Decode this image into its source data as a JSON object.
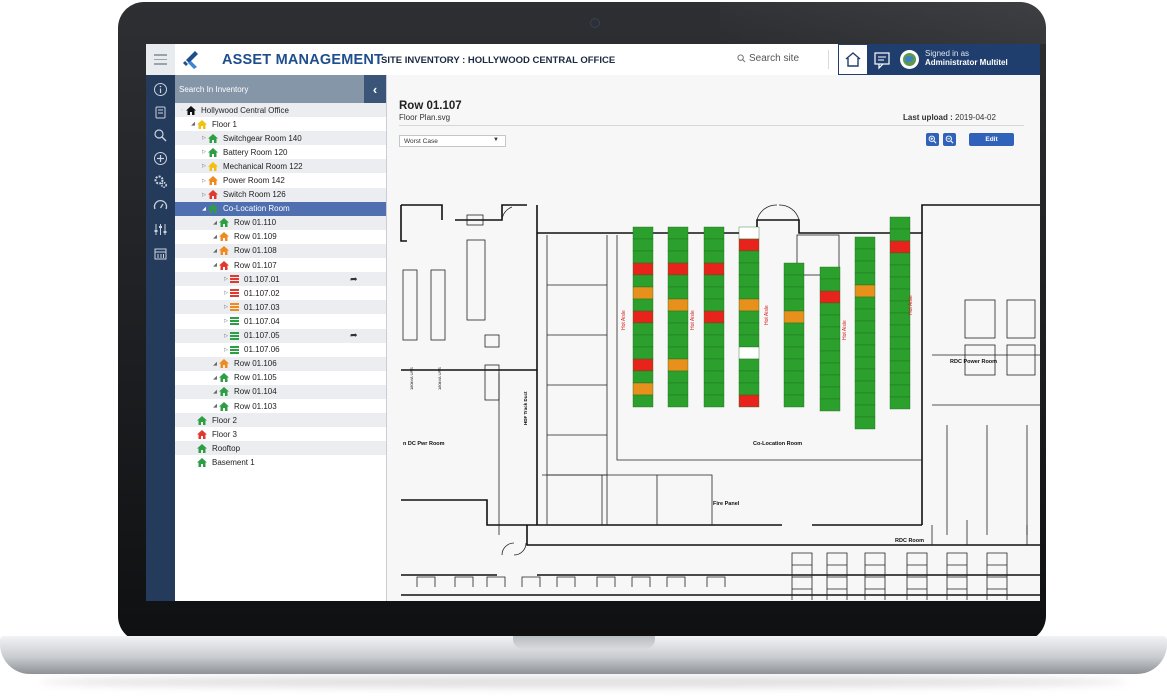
{
  "header": {
    "app_title": "ASSET MANAGEMENT",
    "site_title": "SITE INVENTORY : HOLLYWOOD CENTRAL OFFICE",
    "search_placeholder": "Search site",
    "signed_in_label": "Signed in as",
    "signed_in_user": "Administrator Multitel"
  },
  "sidebar": {
    "search_label": "Search In Inventory",
    "icons": [
      "info-icon",
      "document-icon",
      "search-icon",
      "add-icon",
      "settings-icon",
      "dashboard-icon",
      "sliders-icon",
      "calendar-icon"
    ]
  },
  "tree": [
    {
      "label": "Hollywood Central Office",
      "depth": 0,
      "icon": "home-icon",
      "color": "#111111",
      "toggle": "·"
    },
    {
      "label": "Floor 1",
      "depth": 1,
      "icon": "house-icon",
      "color": "#f2c10f",
      "toggle": "◢"
    },
    {
      "label": "Switchgear Room 140",
      "depth": 2,
      "icon": "house-icon",
      "color": "#2e9e45",
      "toggle": "▷"
    },
    {
      "label": "Battery Room 120",
      "depth": 2,
      "icon": "house-icon",
      "color": "#2e9e45",
      "toggle": "▷"
    },
    {
      "label": "Mechanical Room 122",
      "depth": 2,
      "icon": "house-icon",
      "color": "#f2c10f",
      "toggle": "▷"
    },
    {
      "label": "Power Room 142",
      "depth": 2,
      "icon": "house-icon",
      "color": "#ef8a1f",
      "toggle": "▷"
    },
    {
      "label": "Switch Room 126",
      "depth": 2,
      "icon": "house-icon",
      "color": "#e03a2e",
      "toggle": "▷"
    },
    {
      "label": "Co-Location Room",
      "depth": 2,
      "icon": "house-icon",
      "color": "#2e9e45",
      "toggle": "◢",
      "selected": true
    },
    {
      "label": "Row 01.110",
      "depth": 3,
      "icon": "house-icon",
      "color": "#2e9e45",
      "toggle": "◢"
    },
    {
      "label": "Row 01.109",
      "depth": 3,
      "icon": "house-icon",
      "color": "#ef8a1f",
      "toggle": "◢"
    },
    {
      "label": "Row 01.108",
      "depth": 3,
      "icon": "house-icon",
      "color": "#ef8a1f",
      "toggle": "◢"
    },
    {
      "label": "Row 01.107",
      "depth": 3,
      "icon": "house-icon",
      "color": "#e03a2e",
      "toggle": "◢"
    },
    {
      "label": "01.107.01",
      "depth": 4,
      "icon": "rack-icon",
      "color": "#e03a2e",
      "toggle": "▷",
      "shared": true
    },
    {
      "label": "01.107.02",
      "depth": 4,
      "icon": "rack-icon",
      "color": "#e03a2e",
      "toggle": "▷"
    },
    {
      "label": "01.107.03",
      "depth": 4,
      "icon": "rack-icon",
      "color": "#ef8a1f",
      "toggle": "▷"
    },
    {
      "label": "01.107.04",
      "depth": 4,
      "icon": "rack-icon",
      "color": "#2e9e45",
      "toggle": "▷"
    },
    {
      "label": "01.107.05",
      "depth": 4,
      "icon": "rack-icon",
      "color": "#2e9e45",
      "toggle": "▷",
      "shared": true
    },
    {
      "label": "01.107.06",
      "depth": 4,
      "icon": "rack-icon",
      "color": "#2e9e45",
      "toggle": "▷"
    },
    {
      "label": "Row 01.106",
      "depth": 3,
      "icon": "house-icon",
      "color": "#ef8a1f",
      "toggle": "◢"
    },
    {
      "label": "Row 01.105",
      "depth": 3,
      "icon": "house-icon",
      "color": "#2e9e45",
      "toggle": "◢"
    },
    {
      "label": "Row 01.104",
      "depth": 3,
      "icon": "house-icon",
      "color": "#2e9e45",
      "toggle": "◢"
    },
    {
      "label": "Row 01.103",
      "depth": 3,
      "icon": "house-icon",
      "color": "#2e9e45",
      "toggle": "◢"
    },
    {
      "label": "Floor 2",
      "depth": 1,
      "icon": "house-icon",
      "color": "#2e9e45",
      "toggle": ""
    },
    {
      "label": "Floor 3",
      "depth": 1,
      "icon": "house-icon",
      "color": "#e03a2e",
      "toggle": ""
    },
    {
      "label": "Rooftop",
      "depth": 1,
      "icon": "house-icon",
      "color": "#2e9e45",
      "toggle": ""
    },
    {
      "label": "Basement 1",
      "depth": 1,
      "icon": "house-icon",
      "color": "#2e9e45",
      "toggle": ""
    }
  ],
  "content": {
    "title": "Row 01.107",
    "subtitle": "Floor Plan.svg",
    "last_upload_label": "Last upload :",
    "last_upload_value": "2019-04-02",
    "view_select": "Worst Case",
    "edit_label": "Edit",
    "zoom_in_icon": "zoom-in-icon",
    "zoom_out_icon": "zoom-out-icon"
  },
  "floor_plan": {
    "room_labels": [
      "n DC Pwr Room",
      "Co-Location Room",
      "RDC Power Room",
      "RDC Room",
      "Fire Panel",
      "HDF Track Duct"
    ],
    "hot_aisle_label": "Hot Aisle",
    "ups_labels": [
      "180kVA UPS",
      "180kVA UPS"
    ],
    "rack_rows": [
      [
        "g",
        "g",
        "g",
        "r",
        "g",
        "o",
        "g",
        "r",
        "g",
        "g",
        "g",
        "r",
        "g",
        "o",
        "g",
        "g"
      ],
      [
        "g",
        "g",
        "g",
        "r",
        "g",
        "g",
        "o",
        "g",
        "g",
        "g",
        "g",
        "o",
        "g",
        "g",
        "g",
        "g"
      ],
      [
        "g",
        "g",
        "g",
        "r",
        "g",
        "g",
        "g",
        "r",
        "g",
        "g",
        "g",
        "g",
        "g",
        "g",
        "g",
        "g"
      ],
      [
        "w",
        "r",
        "g",
        "g",
        "g",
        "g",
        "o",
        "g",
        "g",
        "g",
        "w",
        "g",
        "g",
        "g",
        "r",
        "g"
      ],
      [
        "g",
        "g",
        "g",
        "g",
        "o",
        "g",
        "g",
        "g",
        "g",
        "g",
        "g",
        "g",
        "g",
        "g",
        "g",
        "g"
      ],
      [
        "g",
        "g",
        "r",
        "g",
        "g",
        "g",
        "g",
        "g",
        "g",
        "g",
        "g",
        "g",
        "o",
        "g",
        "g",
        "g"
      ],
      [
        "g",
        "g",
        "g",
        "g",
        "o",
        "g",
        "g",
        "g",
        "g",
        "g",
        "g",
        "g",
        "g",
        "g",
        "g",
        "g"
      ],
      [
        "g",
        "g",
        "r",
        "g",
        "g",
        "g",
        "g",
        "g",
        "g",
        "g",
        "g",
        "g",
        "g",
        "g",
        "g",
        "g"
      ]
    ],
    "status_colors": {
      "g": "#2ca02c",
      "r": "#e8231b",
      "o": "#e8901c",
      "w": "#ffffff"
    }
  }
}
